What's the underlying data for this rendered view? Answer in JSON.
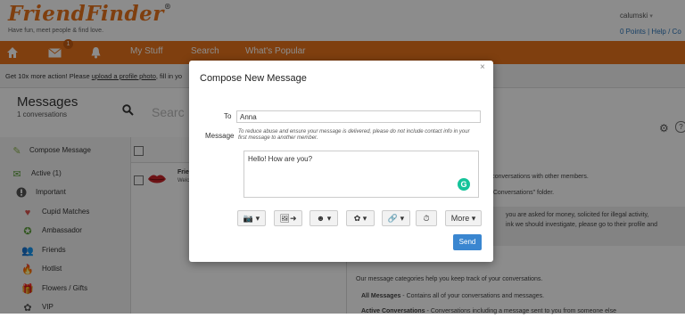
{
  "header": {
    "logo": "FriendFinder",
    "logo_mark": "®",
    "tagline": "Have fun, meet people & find love.",
    "username": "calumski",
    "user_caret": "▾",
    "top_links": "0 Points  |  Help / Co"
  },
  "nav": {
    "home_icon": "home-icon",
    "mail_icon": "mail-icon",
    "bell_icon": "bell-icon",
    "mail_badge": "1",
    "items": [
      "My Stuff",
      "Search",
      "What's Popular"
    ]
  },
  "notice": {
    "prefix": "Get 10x more action! Please ",
    "link": "upload a profile photo",
    "suffix": ", fill in yo"
  },
  "messages": {
    "title": "Messages",
    "count": "1 conversations",
    "search_placeholder": "Searc"
  },
  "sidebar": {
    "items": [
      {
        "label": "Compose Message",
        "icon": "pencil-icon"
      },
      {
        "label": "Active (1)",
        "icon": "mail-icon"
      },
      {
        "label": "Important",
        "icon": "alert-icon"
      },
      {
        "label": "Cupid Matches",
        "icon": "heart-icon"
      },
      {
        "label": "Ambassador",
        "icon": "ambassador-icon"
      },
      {
        "label": "Friends",
        "icon": "friends-icon"
      },
      {
        "label": "Hotlist",
        "icon": "flame-icon"
      },
      {
        "label": "Flowers / Gifts",
        "icon": "gift-icon"
      },
      {
        "label": "VIP",
        "icon": "vip-icon"
      }
    ]
  },
  "list": {
    "row_name": "Frie",
    "row_preview": "Welc"
  },
  "right_panel": {
    "line1": "r conversations with other members.",
    "line2": "g Conversations\" folder.",
    "box1": "you are asked for money, solicited for illegal activity,",
    "box2": "ink we should investigate, please go to their profile and",
    "categories_help": "Our message categories help you keep track of your conversations.",
    "all_messages_bold": "All Messages",
    "all_messages_text": " - Contains all of your conversations and messages.",
    "active_bold": "Active Conversations",
    "active_text": " - Conversations including a message sent to you from someone else"
  },
  "modal": {
    "title": "Compose New Message",
    "close": "×",
    "to_label": "To",
    "to_value": "Anna",
    "message_label": "Message",
    "warning": "To reduce abuse and ensure your message is delivered, please do not include contact info in your first message to another member.",
    "body": "Hello! How are you?",
    "grammarly_icon": "grammarly-icon",
    "grammarly_glyph": "G",
    "toolbar": [
      {
        "icon": "camera-icon",
        "glyph": "📷 ▾"
      },
      {
        "icon": "photo-share-icon",
        "glyph": "🖼➜"
      },
      {
        "icon": "smiley-icon",
        "glyph": "☻ ▾"
      },
      {
        "icon": "flower-icon",
        "glyph": "✿ ▾"
      },
      {
        "icon": "link-icon",
        "glyph": "🔗 ▾"
      },
      {
        "icon": "timer-icon",
        "glyph": "⏱"
      }
    ],
    "more_label": "More ▾",
    "send_label": "Send"
  },
  "colors": {
    "brand_orange": "#e8741c",
    "send_blue": "#3a86d0",
    "grammarly_green": "#15c39a"
  }
}
